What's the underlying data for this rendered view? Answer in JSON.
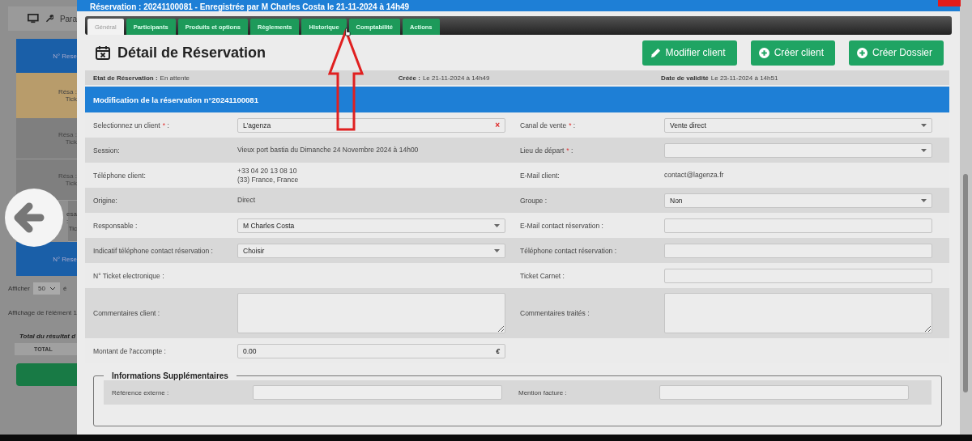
{
  "background_page": {
    "toolbar_label": "Para",
    "cards": [
      {
        "kind": "header",
        "lines": [
          "N° Rese"
        ]
      },
      {
        "kind": "pending",
        "lines": [
          "Résa :",
          "Tick"
        ]
      },
      {
        "kind": "plain",
        "lines": [
          "Résa :",
          "Tick"
        ]
      },
      {
        "kind": "plain",
        "lines": [
          "Résa :",
          "Tick"
        ]
      },
      {
        "kind": "covered",
        "lines": [
          "esa :",
          "Tic"
        ]
      },
      {
        "kind": "header",
        "lines": [
          "N° Rese"
        ]
      }
    ],
    "show_label": "Afficher",
    "show_value": "50",
    "show_suffix": "é",
    "info": "Affichage de l'élément 1",
    "total_title": "Total du résultat d",
    "total_header": "TOTAL"
  },
  "window": {
    "title": "Réservation : 20241100081 - Enregistrée par M Charles Costa le 21-11-2024 à 14h49"
  },
  "tabs": [
    {
      "label": "Général",
      "selected": true
    },
    {
      "label": "Participants",
      "selected": false
    },
    {
      "label": "Produits et options",
      "selected": false
    },
    {
      "label": "Règlements",
      "selected": false
    },
    {
      "label": "Historique",
      "selected": false
    },
    {
      "label": "Comptabilité",
      "selected": false
    },
    {
      "label": "Actions",
      "selected": false
    }
  ],
  "header": {
    "title": "Détail de Réservation",
    "buttons": [
      {
        "label": "Modifier client",
        "kind": "edit"
      },
      {
        "label": "Créer client",
        "kind": "add"
      },
      {
        "label": "Créer Dossier",
        "kind": "add"
      }
    ]
  },
  "info_bar": [
    {
      "label": "Etat de Réservation :",
      "value": "En attente"
    },
    {
      "label": "Créée :",
      "value": "Le 21-11-2024 à 14h49"
    },
    {
      "label": "Date de validité",
      "value": "Le 23-11-2024 à 14h51"
    }
  ],
  "section_title": "Modification de la réservation n°20241100081",
  "rows": [
    {
      "cells": [
        {
          "label": "Selectionnez un client",
          "required_mark": "*",
          "label_end": ":",
          "kind": "combo",
          "value": "L'agenza",
          "clear": "×"
        },
        {
          "label": "Canal de vente",
          "required_mark": "*",
          "label_end": ":",
          "kind": "select",
          "value": "Vente direct"
        }
      ]
    },
    {
      "cells": [
        {
          "label": "Session:",
          "kind": "static",
          "lines": [
            "Vieux port bastia du Dimanche 24 Novembre 2024 à 14h00"
          ]
        },
        {
          "label": "Lieu de départ",
          "required_mark": "*",
          "label_end": ":",
          "kind": "select"
        }
      ]
    },
    {
      "cells": [
        {
          "label": "Téléphone client:",
          "kind": "static",
          "lines": [
            "+33 04 20 13 08 10",
            "(33) France, France"
          ]
        },
        {
          "label": "E-Mail client:",
          "kind": "static",
          "lines": [
            "contact@lagenza.fr"
          ]
        }
      ]
    },
    {
      "cells": [
        {
          "label": "Origine:",
          "kind": "static",
          "lines": [
            "Direct"
          ]
        },
        {
          "label": "Groupe :",
          "kind": "select",
          "value": "Non"
        }
      ]
    },
    {
      "cells": [
        {
          "label": "Responsable :",
          "kind": "select",
          "value": "M Charles Costa"
        },
        {
          "label": "E-Mail contact réservation :",
          "kind": "input"
        }
      ]
    },
    {
      "cells": [
        {
          "label": "Indicatif téléphone contact réservation :",
          "kind": "select",
          "value": "Choisir"
        },
        {
          "label": "Téléphone contact réservation :",
          "kind": "input"
        }
      ]
    },
    {
      "cells": [
        {
          "label": "N° Ticket electronique :",
          "kind": "empty"
        },
        {
          "label": "Ticket Carnet :",
          "kind": "input"
        }
      ]
    },
    {
      "cells": [
        {
          "label": "Commentaires client :",
          "kind": "textarea"
        },
        {
          "label": "Commentaires traités :",
          "kind": "textarea"
        }
      ]
    },
    {
      "cells": [
        {
          "label": "Montant de l'accompte :",
          "kind": "money",
          "value": "0.00",
          "suffix": "€"
        }
      ]
    }
  ],
  "extra": {
    "legend": "Informations Supplémentaires",
    "fields": [
      {
        "label": "Référence externe :"
      },
      {
        "label": "Mention facture :"
      }
    ]
  }
}
